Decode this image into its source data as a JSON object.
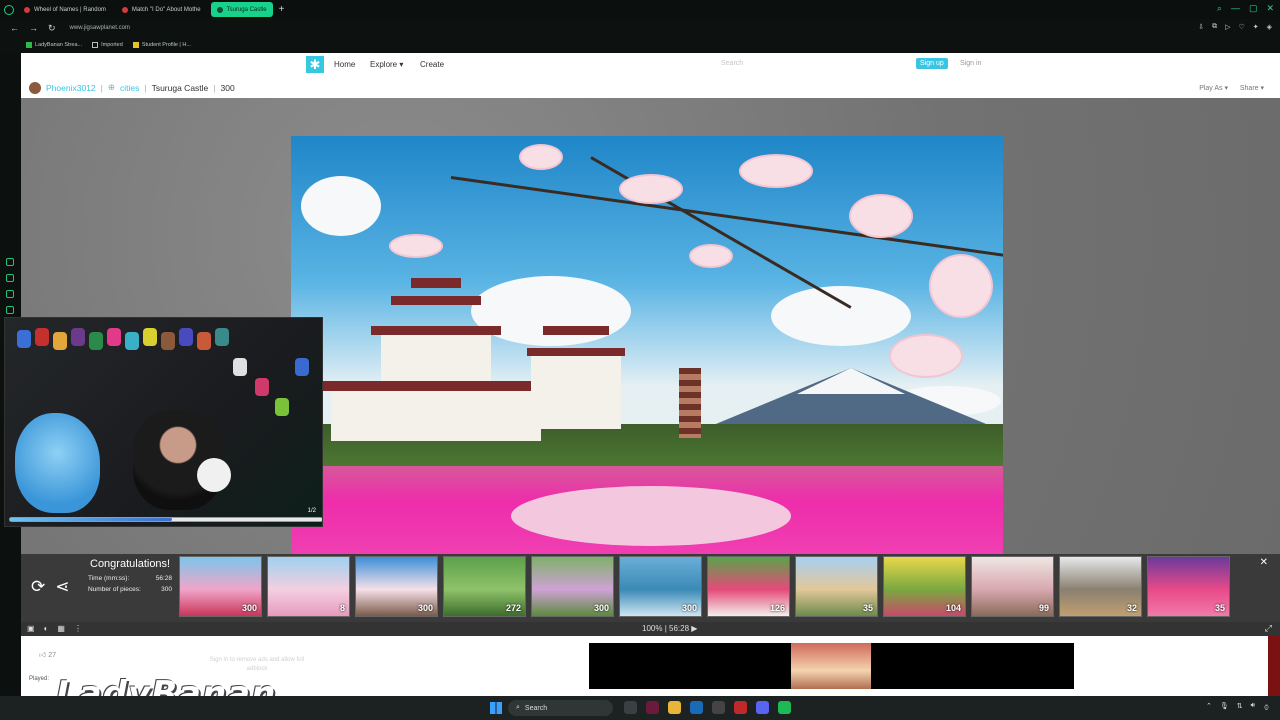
{
  "browser": {
    "tabs": [
      {
        "label": "Wheel of Names | Random"
      },
      {
        "label": "Match \"I Do\" About Mothe"
      },
      {
        "label": "Tsuruga Castle",
        "active": true
      }
    ],
    "url": "www.jigsawplanet.com",
    "bookmarks": [
      "LadyBanan Strea...",
      "Imported",
      "Student Profile | H..."
    ]
  },
  "site": {
    "nav": {
      "home": "Home",
      "explore": "Explore ▾",
      "create": "Create"
    },
    "search_placeholder": "Search",
    "signup": "Sign up",
    "signin": "Sign in"
  },
  "breadcrumb": {
    "user": "Phoenix3012",
    "category": "cities",
    "title": "Tsuruga Castle",
    "pieces": "300",
    "play_as": "Play As ▾",
    "share": "Share ▾"
  },
  "webcam": {
    "page_indicator": "1/2",
    "progress": 0.52
  },
  "congrats": {
    "title": "Congratulations!",
    "time_label": "Time (mm:ss):",
    "time_value": "56:28",
    "pieces_label": "Number of pieces:",
    "pieces_value": "300",
    "thumbnails": [
      {
        "count": "300",
        "colors": [
          "#7cc6ea",
          "#f0a5c8",
          "#c9355a"
        ]
      },
      {
        "count": "8",
        "colors": [
          "#9fd0f0",
          "#f4cfe0",
          "#e69abe"
        ]
      },
      {
        "count": "300",
        "colors": [
          "#3d8fd8",
          "#f6e0e8",
          "#7a5a4a"
        ]
      },
      {
        "count": "272",
        "colors": [
          "#5ba04a",
          "#8fc26a",
          "#3c6d2c"
        ]
      },
      {
        "count": "300",
        "colors": [
          "#7fb06a",
          "#cfa2d6",
          "#5d8a3e"
        ]
      },
      {
        "count": "300",
        "colors": [
          "#6aaed8",
          "#3a8ab6",
          "#cfe6f2"
        ]
      },
      {
        "count": "126",
        "colors": [
          "#5aa34a",
          "#e54a7a",
          "#f3f0ea"
        ]
      },
      {
        "count": "35",
        "colors": [
          "#a8cff0",
          "#e2c89a",
          "#6d8a4a"
        ]
      },
      {
        "count": "104",
        "colors": [
          "#e8d84a",
          "#7aa840",
          "#c84a6a"
        ]
      },
      {
        "count": "99",
        "colors": [
          "#eee6e2",
          "#d8a8b0",
          "#8a6a5a"
        ]
      },
      {
        "count": "32",
        "colors": [
          "#e6e8ea",
          "#8a8070",
          "#c0a070"
        ]
      },
      {
        "count": "35",
        "colors": [
          "#6a3a9a",
          "#e84a8a",
          "#f07aa8"
        ]
      }
    ]
  },
  "toolbar": {
    "zoom": "100%",
    "time": "56:28 ▶"
  },
  "footer": {
    "likes": "27",
    "played_label": "Played:",
    "ad_note": "Sign in to remove ads and allow full adblock"
  },
  "overlay": {
    "watermark": "LadyBanan"
  },
  "taskbar": {
    "search": "Search"
  }
}
